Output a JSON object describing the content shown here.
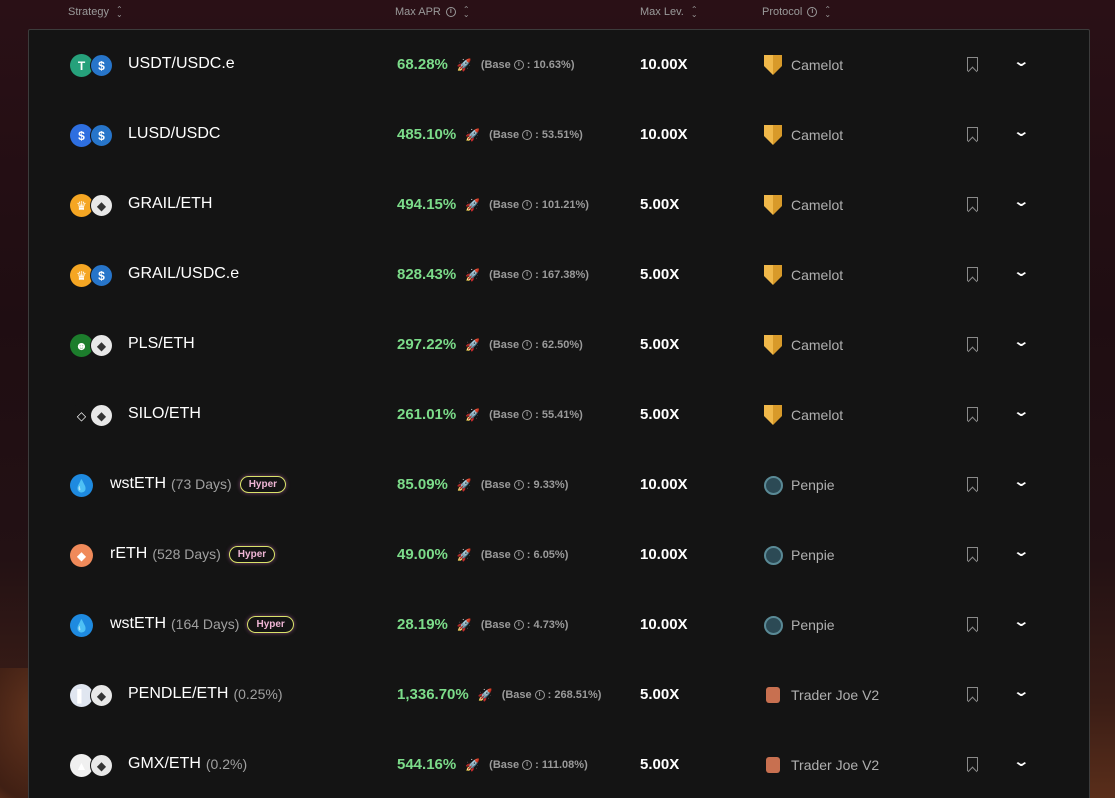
{
  "header": {
    "strategy": "Strategy",
    "max_apr": "Max APR",
    "max_lev": "Max Lev.",
    "protocol": "Protocol"
  },
  "rows": [
    {
      "name": "USDT/USDC.e",
      "sub": "",
      "hyper": "",
      "apr": "68.28%",
      "base": "(Base",
      "base_val": ": 10.63%)",
      "lev": "10.00X",
      "protocol": "Camelot",
      "protocol_icon": "camelot-icon",
      "coin_a": "T",
      "coin_a_color": "#26a17b",
      "coin_b": "$",
      "coin_b_color": "#2775ca"
    },
    {
      "name": "LUSD/USDC",
      "sub": "",
      "hyper": "",
      "apr": "485.10%",
      "base": "(Base",
      "base_val": ": 53.51%)",
      "lev": "10.00X",
      "protocol": "Camelot",
      "protocol_icon": "camelot-icon",
      "coin_a": "$",
      "coin_a_color": "#2e6fe0",
      "coin_b": "$",
      "coin_b_color": "#2775ca"
    },
    {
      "name": "GRAIL/ETH",
      "sub": "",
      "hyper": "",
      "apr": "494.15%",
      "base": "(Base",
      "base_val": ": 101.21%)",
      "lev": "5.00X",
      "protocol": "Camelot",
      "protocol_icon": "camelot-icon",
      "coin_a": "♛",
      "coin_a_color": "#f5a623",
      "coin_b": "◆",
      "coin_b_color": "#e8e8e8"
    },
    {
      "name": "GRAIL/USDC.e",
      "sub": "",
      "hyper": "",
      "apr": "828.43%",
      "base": "(Base",
      "base_val": ": 167.38%)",
      "lev": "5.00X",
      "protocol": "Camelot",
      "protocol_icon": "camelot-icon",
      "coin_a": "♛",
      "coin_a_color": "#f5a623",
      "coin_b": "$",
      "coin_b_color": "#2775ca"
    },
    {
      "name": "PLS/ETH",
      "sub": "",
      "hyper": "",
      "apr": "297.22%",
      "base": "(Base",
      "base_val": ": 62.50%)",
      "lev": "5.00X",
      "protocol": "Camelot",
      "protocol_icon": "camelot-icon",
      "coin_a": "☻",
      "coin_a_color": "#1c7d2c",
      "coin_b": "◆",
      "coin_b_color": "#e8e8e8"
    },
    {
      "name": "SILO/ETH",
      "sub": "",
      "hyper": "",
      "apr": "261.01%",
      "base": "(Base",
      "base_val": ": 55.41%)",
      "lev": "5.00X",
      "protocol": "Camelot",
      "protocol_icon": "camelot-icon",
      "coin_a": "◇",
      "coin_a_color": "#141414",
      "coin_b": "◆",
      "coin_b_color": "#e8e8e8"
    },
    {
      "name": "wstETH",
      "sub": "(73 Days)",
      "hyper": "Hyper",
      "apr": "85.09%",
      "base": "(Base",
      "base_val": ": 9.33%)",
      "lev": "10.00X",
      "protocol": "Penpie",
      "protocol_icon": "penpie-icon",
      "coin_a": "💧",
      "coin_a_color": "#1e8ae0",
      "coin_b": "",
      "coin_b_color": ""
    },
    {
      "name": "rETH",
      "sub": "(528 Days)",
      "hyper": "Hyper",
      "apr": "49.00%",
      "base": "(Base",
      "base_val": ": 6.05%)",
      "lev": "10.00X",
      "protocol": "Penpie",
      "protocol_icon": "penpie-icon",
      "coin_a": "◆",
      "coin_a_color": "#f08a5a",
      "coin_b": "",
      "coin_b_color": ""
    },
    {
      "name": "wstETH",
      "sub": "(164 Days)",
      "hyper": "Hyper",
      "apr": "28.19%",
      "base": "(Base",
      "base_val": ": 4.73%)",
      "lev": "10.00X",
      "protocol": "Penpie",
      "protocol_icon": "penpie-icon",
      "coin_a": "💧",
      "coin_a_color": "#1e8ae0",
      "coin_b": "",
      "coin_b_color": ""
    },
    {
      "name": "PENDLE/ETH",
      "sub": "(0.25%)",
      "hyper": "",
      "apr": "1,336.70%",
      "base": "(Base",
      "base_val": ": 268.51%)",
      "lev": "5.00X",
      "protocol": "Trader Joe V2",
      "protocol_icon": "trader-joe-icon",
      "coin_a": "▌",
      "coin_a_color": "#e0e6f0",
      "coin_b": "◆",
      "coin_b_color": "#e8e8e8"
    },
    {
      "name": "GMX/ETH",
      "sub": "(0.2%)",
      "hyper": "",
      "apr": "544.16%",
      "base": "(Base",
      "base_val": ": 111.08%)",
      "lev": "5.00X",
      "protocol": "Trader Joe V2",
      "protocol_icon": "trader-joe-icon",
      "coin_a": "▲",
      "coin_a_color": "#f0f0f0",
      "coin_b": "◆",
      "coin_b_color": "#e8e8e8"
    }
  ]
}
